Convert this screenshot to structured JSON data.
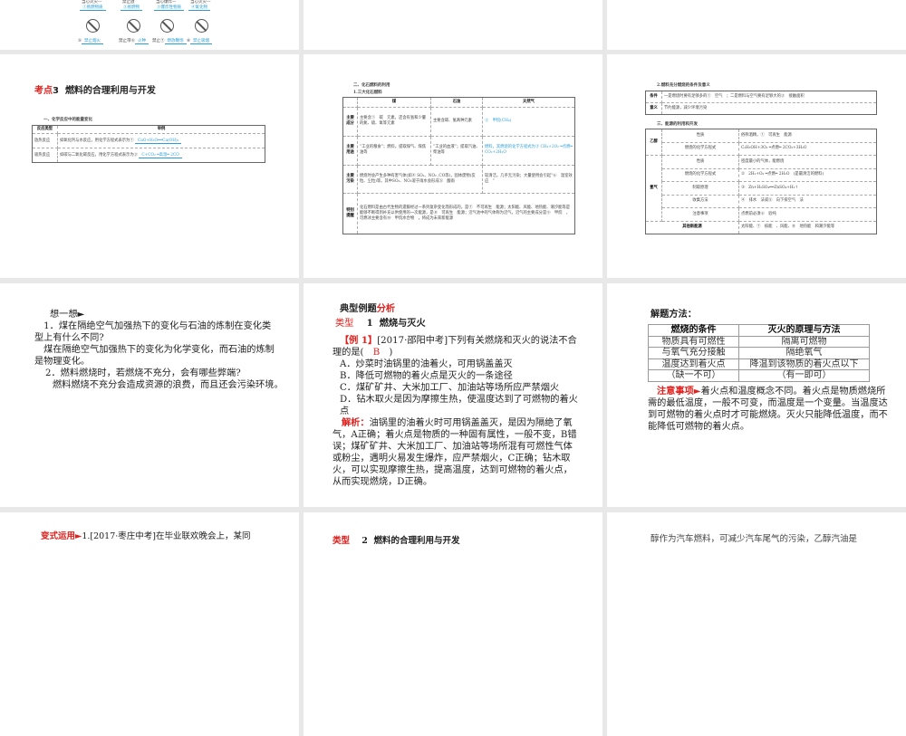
{
  "slide1": {
    "top_labels": [
      "当心火灾—",
      "禁止放",
      "当心爆炸—",
      "当心火灾—"
    ],
    "blanks": [
      "①易燃物质",
      "②易燃物",
      "③爆炸性物质",
      "④氧化物"
    ],
    "bottom_labels": [
      {
        "pre": "⑤",
        "ans": "禁止烟火"
      },
      {
        "pre": "禁止带⑥",
        "ans": "火种"
      },
      {
        "pre": "禁止⑦",
        "ans": "燃放鞭炮"
      },
      {
        "pre": "⑧",
        "ans": "禁止吸烟"
      }
    ]
  },
  "slide2": {
    "title_prefix": "考点",
    "title_num": "3",
    "title": "燃料的合理利用与开发",
    "subtitle": "一、化学反应中的能量变化",
    "headers": [
      "反应类型",
      "举例"
    ],
    "rows": [
      [
        "放热反应",
        "如氧化钙与水反应，用化学方程式表示为①",
        "CaO+H₂O══Ca(OH)₂"
      ],
      [
        "吸热反应",
        "如碳与二氧化碳反应，用化学方程式表示为②",
        "C+CO₂ ═高温═ 2CO"
      ]
    ]
  },
  "slide3": {
    "subtitle1": "二、化石燃料的利用",
    "subtitle2": "1.三大化石燃料",
    "headers": [
      "",
      "煤",
      "石油",
      "天然气"
    ],
    "rows": [
      [
        "主要成分",
        "主要含①　碳　元素，还含有氢和少量的氮、硫、氧等元素",
        "主要含碳、氢两种元素",
        "②　甲烷(CH₄)"
      ],
      [
        "主要用途",
        "“工业的粮食”；燃料，提取煤气、煤焦油等",
        "“工业的血液”；提取汽油、柴油等",
        "燃料，其燃烧的化学方程式为③ CH₄+2O₂ ═点燃═ CO₂+2H₂O"
      ],
      [
        "主要污染",
        "燃烧时会产生多种有害气体(如④ SO₂、NO₂ ,CO等)，固体废物(炭粒、尘粒)等。其中SO₂、NO₂溶于雨水会形成⑤　酸雨",
        "",
        "较清洁，几乎无污染；大量使用会引起“⑥　温室效应　”"
      ],
      [
        "特别提醒",
        "化石燃料是由古代生物的遗骸经过一系列复杂变化而形成的，是⑦　不可再生　能源；太阳能、风能、地热能、潮汐能等是能够不断得到补充以供使用的一次能源，是⑧　可再生　能源；沼气池中的气体称为沼气，沼气的主要成分是⑨　甲烷　，可燃冰主要含有⑩　甲烷水合物　，将成为未来新能源",
        "",
        ""
      ]
    ]
  },
  "slide4": {
    "subtitle1": "2.燃料充分燃烧的条件及意义",
    "cond": [
      [
        "条件",
        "一是燃烧时要有足够多的①　空气　；二是燃料与空气要有足够大的②　接触面积"
      ],
      [
        "意义",
        "节约能源，减少环境污染"
      ]
    ],
    "subtitle2": "三、能源的利用和开发",
    "rows": [
      [
        "乙醇",
        "性质",
        "俗称酒精，①　可再生　能源"
      ],
      [
        "",
        "燃烧的化学方程式",
        "C₂H₅OH+3O₂ ═点燃═ 2CO₂+3H₂O"
      ],
      [
        "氢气",
        "性质",
        "密度最小的气体，能燃烧"
      ],
      [
        "",
        "燃烧的化学方程式",
        "②　2H₂+O₂ ═点燃═ 2H₂O　(是最清洁的燃料)"
      ],
      [
        "",
        "制取原理",
        "③　Zn+H₂SO₄══ZnSO₄+H₂↑"
      ],
      [
        "",
        "收集方法",
        "④　排水　法或⑤　向下排空气　法"
      ],
      [
        "",
        "注意事项",
        "点燃前必须⑥　验纯"
      ],
      [
        "其他新能源",
        "",
        "太阳能、⑦　核能　、风能、⑧　地热能　和潮汐能等"
      ]
    ]
  },
  "slide5": {
    "heading": "想一想►",
    "q1": "　1．煤在隔绝空气加强热下的变化与石油的炼制在变化类型上有什么不同?",
    "a1": "　煤在隔绝空气加强热下的变化为化学变化，而石油的炼制是物理变化。",
    "q2": "2．燃料燃烧时，若燃烧不充分，会有哪些弊端?",
    "a2": "燃料燃烧不充分会造成资源的浪费，而且还会污染环境。"
  },
  "slide6": {
    "heading_black": "典型例题",
    "heading_red": "分析",
    "type_label": "类型",
    "type_num": "1",
    "type_title": "燃烧与灭火",
    "ex_label": "【例 1】",
    "ex_text": "[2017·邵阳中考]下列有关燃烧和灭火的说法不合理的是(　",
    "answer": "B",
    "ex_close": "　)",
    "options": [
      "A．炒菜时油锅里的油着火，可用锅盖盖灭",
      "B．降低可燃物的着火点是灭火的一条途径",
      "C．煤矿矿井、大米加工厂、加油站等场所应严禁烟火",
      "D．钻木取火是因为摩擦生热，使温度达到了可燃物的着火点"
    ],
    "analysis_label": "解析：",
    "analysis": "油锅里的油着火时可用锅盖盖灭，是因为隔绝了氧气，A正确；着火点是物质的一种固有属性，一般不变，B错误；煤矿矿井、大米加工厂、加油站等场所混有可燃性气体或粉尘，遇明火易发生爆炸，应严禁烟火，C正确；钻木取火，可以实现摩擦生热，提高温度，达到可燃物的着火点，从而实现燃烧，D正确。"
  },
  "slide7": {
    "heading": "解题方法：",
    "headers": [
      "燃烧的条件",
      "灭火的原理与方法"
    ],
    "rows": [
      [
        "物质具有可燃性",
        "隔离可燃物"
      ],
      [
        "与氧气充分接触",
        "隔绝氧气"
      ],
      [
        "温度达到着火点",
        "降温到该物质的着火点以下"
      ],
      [
        "（缺一不可）",
        "（有一即可）"
      ]
    ],
    "note_label": "注意事项►",
    "note": "着火点和温度概念不同。着火点是物质燃烧所需的最低温度，一般不可变，而温度是一个变量。当温度达到可燃物的着火点时才可能燃烧。灭火只能降低温度，而不能降低可燃物的着火点。"
  },
  "slide8": {
    "label": "变式运用►",
    "text": "1.[2017·枣庄中考]在毕业联欢晚会上，某同"
  },
  "slide9": {
    "type_label": "类型",
    "type_num": "2",
    "type_title": "燃料的合理利用与开发"
  },
  "slide10": {
    "text": "醇作为汽车燃料，可减少汽车尾气的污染，乙醇汽油是"
  }
}
